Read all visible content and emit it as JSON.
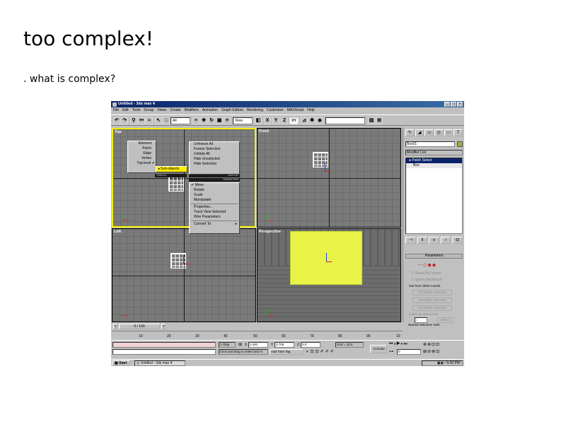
{
  "slide": {
    "title": "too complex!",
    "bullet": ". what is complex?"
  },
  "window": {
    "title": "Untitled - 3ds max 4",
    "buttons": [
      "_",
      "□",
      "×"
    ]
  },
  "menu": [
    "File",
    "Edit",
    "Tools",
    "Group",
    "Views",
    "Create",
    "Modifiers",
    "Animation",
    "Graph Editors",
    "Rendering",
    "Customize",
    "MAXScript",
    "Help"
  ],
  "toolbar": {
    "selection_filter": "All",
    "ref_coord": "View",
    "axes": [
      "X",
      "Y",
      "Z",
      "XY"
    ]
  },
  "viewports": {
    "top": "Top",
    "front": "Front",
    "left": "Left",
    "perspective": "Perspective"
  },
  "quad_menu": {
    "left_items": [
      "Element",
      "Patch",
      "Edge",
      "Vertex",
      "Top-level"
    ],
    "left_selected": "Sub-objects",
    "right_items": [
      "Unfreeze All",
      "Freeze Selection",
      "Unhide All",
      "Hide Unselected",
      "Hide Selection"
    ],
    "header_tools": "TOOLS 1",
    "header_display": "DISPLAY",
    "header_transform": "TRANSFORM",
    "transform_items": [
      "Move",
      "Rotate",
      "Scale",
      "Manipulate",
      "Properties...",
      "Track View Selected",
      "Wire Parameters",
      "Convert To:"
    ]
  },
  "command_panel": {
    "object_name": "Box01",
    "modifier_list": "Modifier List",
    "stack": [
      "Patch Select",
      "Box"
    ],
    "parameters": "Parameters",
    "select_by_vertex": "Select By Vertex",
    "ignore_backfaces": "Ignore Backfaces",
    "get_from_other": "Get from Other Levels",
    "get_vertex": "Get Vertex Selection",
    "get_edge": "Get Edge Selection",
    "get_patch": "Get Patch Selection",
    "select_by_material": "Select by Material ID",
    "id_value": "1",
    "select_btn": "Select",
    "named_sets": "Named Selection Sets"
  },
  "timeline": {
    "frame": "0 / 100",
    "ticks": [
      "10",
      "20",
      "30",
      "40",
      "50",
      "60",
      "70",
      "80",
      "90",
      "10"
    ]
  },
  "status": {
    "objects": "1 Obje",
    "x": "2.491",
    "y": "3.705",
    "z": "0.0",
    "grid": "Grid = 10.0",
    "prompt": "Click and drag to select and m",
    "add_time_tag": "Add Time Tag",
    "animate": "Animate",
    "frame_field": "0"
  },
  "taskbar": {
    "start": "Start",
    "task": "Untitled - 3ds max 4",
    "clock": "5:42 PM"
  }
}
